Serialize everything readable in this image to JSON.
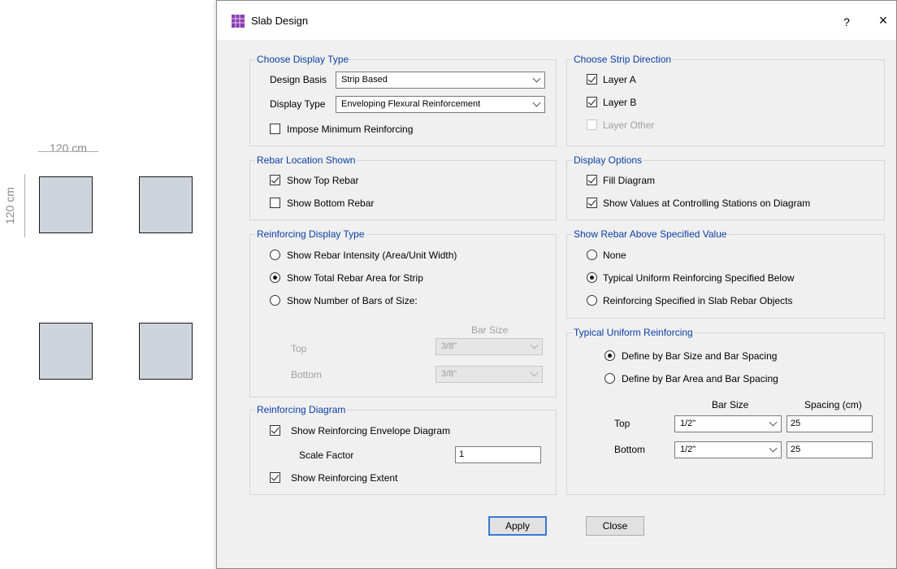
{
  "background": {
    "dim_width": "120 cm",
    "dim_height": "120 cm"
  },
  "dialog": {
    "title": "Slab Design",
    "help": "?",
    "close_glyph": "×"
  },
  "display_type": {
    "title": "Choose Display Type",
    "design_basis_label": "Design Basis",
    "design_basis_value": "Strip Based",
    "display_type_label": "Display Type",
    "display_type_value": "Enveloping Flexural Reinforcement",
    "impose_min_label": "Impose Minimum Reinforcing"
  },
  "strip_direction": {
    "title": "Choose Strip Direction",
    "layer_a": "Layer A",
    "layer_b": "Layer B",
    "layer_other": "Layer Other"
  },
  "rebar_location": {
    "title": "Rebar Location Shown",
    "top": "Show Top Rebar",
    "bottom": "Show Bottom Rebar"
  },
  "display_options": {
    "title": "Display Options",
    "fill": "Fill Diagram",
    "values": "Show Values at Controlling Stations on Diagram"
  },
  "reinf_display_type": {
    "title": "Reinforcing Display Type",
    "opt1": "Show Rebar Intensity (Area/Unit Width)",
    "opt2": "Show Total Rebar Area for Strip",
    "opt3": "Show Number of Bars of Size:",
    "bar_size_header": "Bar Size",
    "top_label": "Top",
    "top_value": "3/8\"",
    "bottom_label": "Bottom",
    "bottom_value": "3/8\""
  },
  "show_rebar_above": {
    "title": "Show Rebar Above Specified Value",
    "opt1": "None",
    "opt2": "Typical Uniform Reinforcing Specified Below",
    "opt3": "Reinforcing Specified in Slab Rebar Objects"
  },
  "typical_uniform": {
    "title": "Typical Uniform Reinforcing",
    "opt1": "Define by Bar Size and Bar Spacing",
    "opt2": "Define by Bar Area and Bar Spacing",
    "bar_size_header": "Bar Size",
    "spacing_header": "Spacing  (cm)",
    "top_label": "Top",
    "top_bar": "1/2\"",
    "top_spacing": "25",
    "bottom_label": "Bottom",
    "bottom_bar": "1/2\"",
    "bottom_spacing": "25"
  },
  "reinf_diagram": {
    "title": "Reinforcing Diagram",
    "envelope": "Show Reinforcing Envelope Diagram",
    "scale_label": "Scale Factor",
    "scale_value": "1",
    "extent": "Show Reinforcing Extent"
  },
  "buttons": {
    "apply": "Apply",
    "close": "Close"
  }
}
